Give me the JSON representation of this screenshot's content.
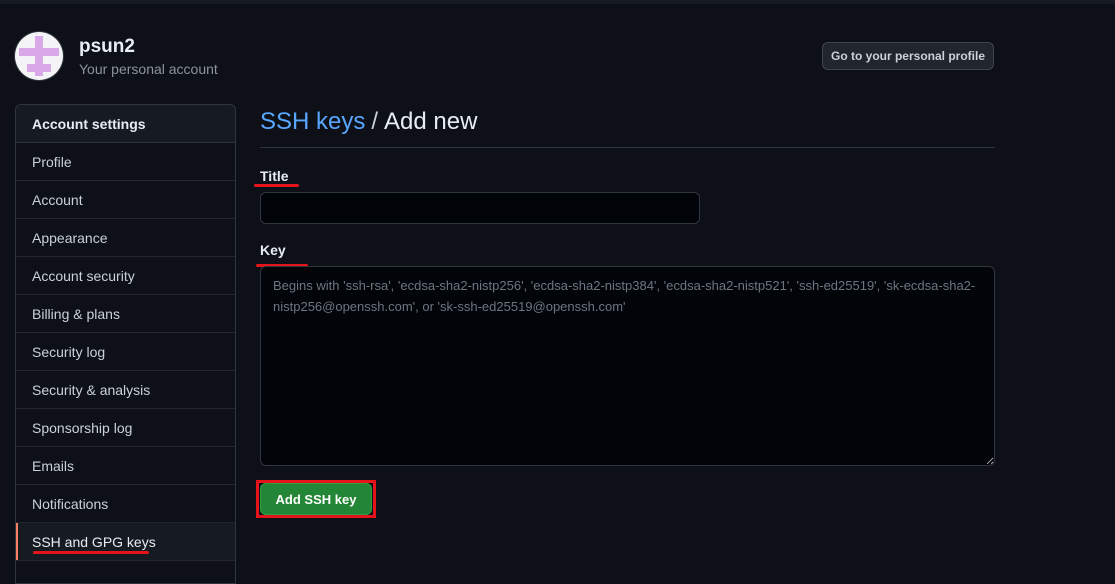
{
  "account": {
    "name": "psun2",
    "subtitle": "Your personal account",
    "profile_button": "Go to your personal profile"
  },
  "sidebar": {
    "header": "Account settings",
    "items": [
      {
        "label": "Profile"
      },
      {
        "label": "Account"
      },
      {
        "label": "Appearance"
      },
      {
        "label": "Account security"
      },
      {
        "label": "Billing & plans"
      },
      {
        "label": "Security log"
      },
      {
        "label": "Security & analysis"
      },
      {
        "label": "Sponsorship log"
      },
      {
        "label": "Emails"
      },
      {
        "label": "Notifications"
      },
      {
        "label": "SSH and GPG keys",
        "active": true
      }
    ]
  },
  "heading": {
    "link": "SSH keys",
    "separator": "/",
    "current": "Add new"
  },
  "form": {
    "title_label": "Title",
    "title_value": "",
    "key_label": "Key",
    "key_value": "",
    "key_placeholder": "Begins with 'ssh-rsa', 'ecdsa-sha2-nistp256', 'ecdsa-sha2-nistp384', 'ecdsa-sha2-nistp521', 'ssh-ed25519', 'sk-ecdsa-sha2-nistp256@openssh.com', or 'sk-ssh-ed25519@openssh.com'",
    "submit_label": "Add SSH key"
  },
  "colors": {
    "background": "#0d1117",
    "link": "#58a6ff",
    "primary_button": "#238636",
    "annotation_red": "#e5141b",
    "active_indicator": "#f78166"
  }
}
